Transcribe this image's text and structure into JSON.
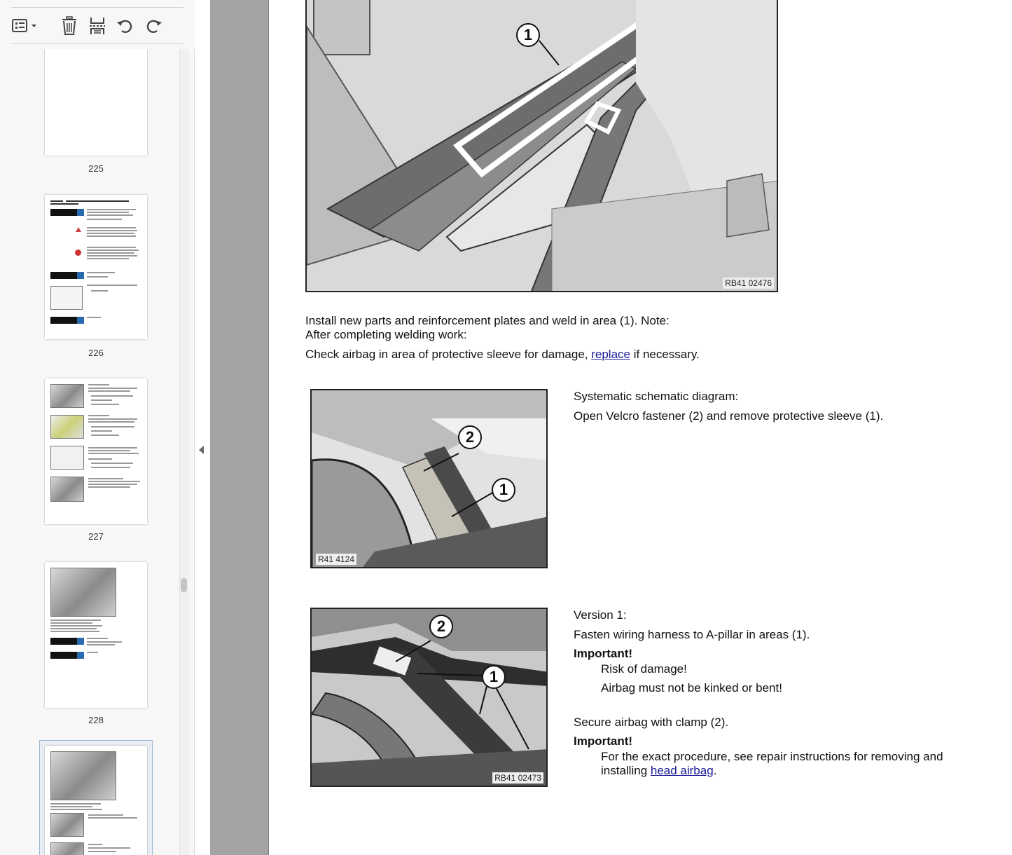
{
  "toolbar": {
    "buttons": [
      "page-view-menu",
      "delete",
      "extract",
      "undo",
      "redo"
    ]
  },
  "thumbnails": [
    {
      "page_number": "225"
    },
    {
      "page_number": "226"
    },
    {
      "page_number": "227"
    },
    {
      "page_number": "228"
    }
  ],
  "page": {
    "figure1": {
      "code": "RB41 02476",
      "callout_1": "1"
    },
    "step1": {
      "line1": "Install new parts and reinforcement plates and weld in area (1). Note:",
      "line2": "After completing welding work:",
      "line3_before": "Check airbag in area of protective sleeve for damage, ",
      "line3_link": "replace",
      "line3_after": " if necessary."
    },
    "figure2": {
      "code": "R41 4124",
      "callout_1": "1",
      "callout_2": "2"
    },
    "step2": {
      "heading": "Systematic schematic diagram:",
      "text": "Open Velcro fastener (2) and remove protective sleeve (1)."
    },
    "figure3": {
      "code": "RB41 02473",
      "callout_1": "1",
      "callout_2": "2"
    },
    "step3": {
      "version": "Version 1:",
      "text": "Fasten wiring harness to A-pillar in areas (1).",
      "important1": "Important!",
      "risk": "Risk of damage!",
      "airbag_note": "Airbag must not be kinked or bent!",
      "secure": "Secure airbag with clamp (2).",
      "important2": "Important!",
      "exact_line1": "For the exact procedure, see repair instructions for removing and",
      "exact_line2_before": "installing ",
      "exact_link": "head airbag",
      "exact_line2_after": "."
    }
  }
}
